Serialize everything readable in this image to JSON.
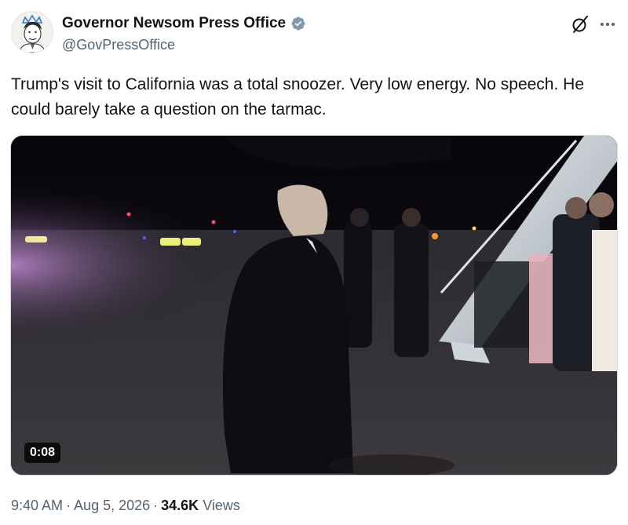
{
  "author": {
    "display_name": "Governor Newsom Press Office",
    "handle": "@GovPressOffice",
    "verified": true,
    "avatar_icon": "avatar-cartoon-crown"
  },
  "tweet": {
    "text": "Trump's visit to California was a total snoozer. Very low energy. No speech. He could barely take a question on the tarmac."
  },
  "media": {
    "type": "video",
    "duration": "0:08"
  },
  "meta": {
    "time": "9:40 AM",
    "separator": "·",
    "date": "Aug 5, 2026",
    "views_count": "34.6K",
    "views_label": "Views"
  },
  "colors": {
    "text": "#0f1419",
    "secondary": "#536471",
    "verified": "#829aab",
    "border": "#cfd9de"
  },
  "icons": {
    "grok": "grok-icon",
    "more": "more-icon"
  }
}
